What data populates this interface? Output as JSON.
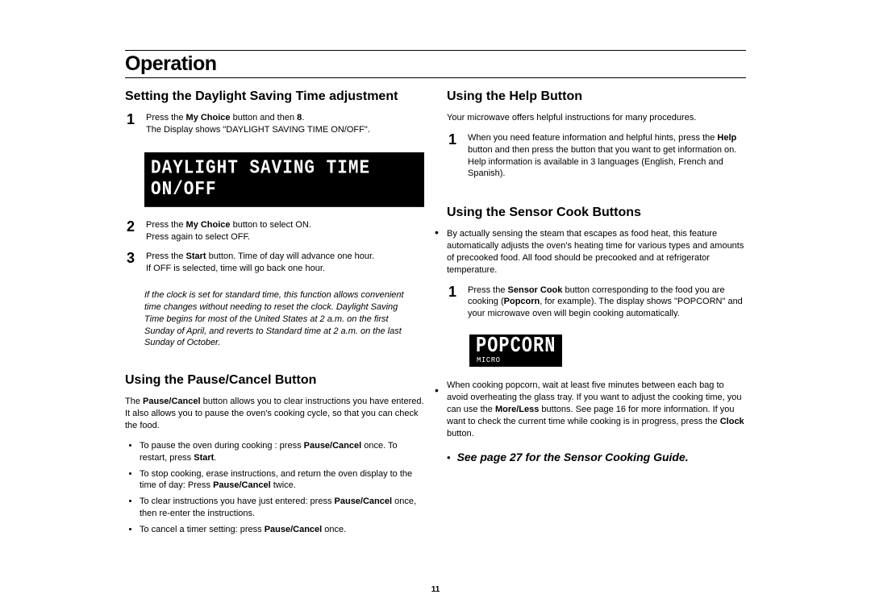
{
  "pageTitle": "Operation",
  "pageNumber": "11",
  "left": {
    "daylight": {
      "heading": "Setting the Daylight Saving Time adjustment",
      "step1_a": "Press the ",
      "step1_b": "My Choice",
      "step1_c": " button and then ",
      "step1_d": "8",
      "step1_e": ".",
      "step1_line2": "The Display shows     \"DAYLIGHT SAVING TIME ON/OFF\".",
      "display": "DAYLIGHT SAVING TIME ON/OFF",
      "step2_a": "Press the ",
      "step2_b": "My Choice",
      "step2_c": " button to select ON.",
      "step2_line2": "Press again to select OFF.",
      "step3_a": "Press the ",
      "step3_b": "Start",
      "step3_c": " button. Time of day will advance one hour.",
      "step3_line2": "If OFF is selected, time will go back one hour.",
      "note": "If the clock is set for standard time, this function allows convenient time changes without needing to reset the clock. Daylight Saving Time begins for most of the United States at 2 a.m. on the first Sunday of April, and reverts to Standard time at 2 a.m. on the last Sunday of October."
    },
    "pause": {
      "heading": "Using the Pause/Cancel Button",
      "intro_a": "The ",
      "intro_b": "Pause/Cancel",
      "intro_c": " button allows you to clear instructions you have entered. It also allows you to pause the oven's cooking cycle, so that you can check the food.",
      "b1_a": "To pause the oven during cooking : press ",
      "b1_b": "Pause/Cancel",
      "b1_c": " once. To restart, press ",
      "b1_d": "Start",
      "b1_e": ".",
      "b2_a": "To stop cooking, erase instructions, and return the oven display to the time of day: Press ",
      "b2_b": "Pause/Cancel",
      "b2_c": " twice.",
      "b3_a": "To clear instructions you have just entered: press ",
      "b3_b": "Pause/Cancel",
      "b3_c": " once, then re-enter the instructions.",
      "b4_a": "To cancel a timer setting: press ",
      "b4_b": "Pause/Cancel",
      "b4_c": " once."
    }
  },
  "right": {
    "help": {
      "heading": "Using the Help Button",
      "intro": "Your microwave offers helpful instructions for many procedures.",
      "step1_a": "When you need feature information and helpful hints, press the ",
      "step1_b": "Help",
      "step1_c": " button and then press the button that you want to get information on. Help information is available in 3 languages (English, French and Spanish)."
    },
    "sensor": {
      "heading": "Using the Sensor Cook Buttons",
      "intro": "By actually sensing the steam that escapes as food heat, this feature automatically adjusts the oven's heating time for various types and amounts of precooked food. All food should be precooked and at refrigerator temperature.",
      "step1_a": "Press the ",
      "step1_b": "Sensor Cook",
      "step1_c": " button corresponding to the food you are cooking (",
      "step1_d": "Popcorn",
      "step1_e": ", for example). The display shows \"POPCORN\" and your microwave oven will begin cooking automatically.",
      "display_big": "POPCORN",
      "display_small": "MICRO",
      "para_a": "When cooking popcorn, wait at least five minutes between each bag to avoid overheating the glass tray. If you want to adjust the cooking time, you can use the ",
      "para_b": "More/Less",
      "para_c": " buttons. See page 16 for more information. If you want to check the current time while cooking is in progress, press the ",
      "para_d": "Clock",
      "para_e": " button.",
      "crossref": "See page 27 for the Sensor Cooking Guide."
    }
  }
}
